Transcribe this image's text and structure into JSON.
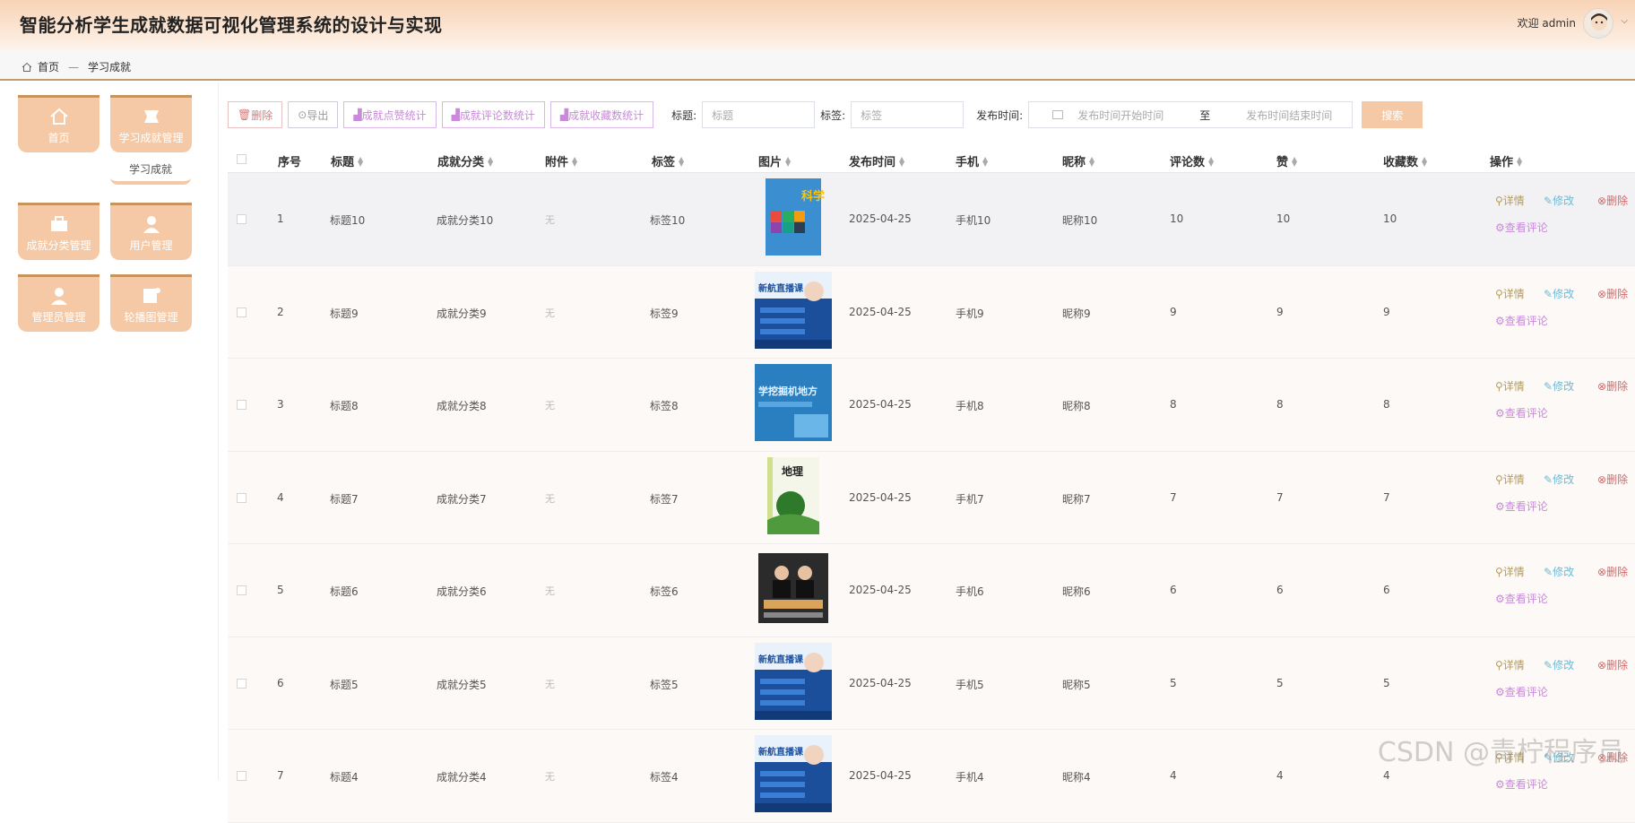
{
  "header": {
    "title": "智能分析学生成就数据可视化管理系统的设计与实现",
    "welcome": "欢迎 admin"
  },
  "breadcrumb": {
    "home": "首页",
    "separator": "—",
    "current": "学习成就"
  },
  "sidebar": {
    "items": [
      {
        "label": "首页",
        "icon": "home-icon"
      },
      {
        "label": "学习成就管理",
        "icon": "book-icon"
      },
      {
        "label": "成就分类管理",
        "icon": "briefcase-icon"
      },
      {
        "label": "用户管理",
        "icon": "user-icon"
      },
      {
        "label": "管理员管理",
        "icon": "admin-icon"
      },
      {
        "label": "轮播图管理",
        "icon": "carousel-icon"
      }
    ],
    "submenu": "学习成就"
  },
  "toolbar": {
    "delete": "删除",
    "export": "导出",
    "stat_likes": "成就点赞统计",
    "stat_comments": "成就评论数统计",
    "stat_favorites": "成就收藏数统计",
    "title_label": "标题:",
    "title_placeholder": "标题",
    "tag_label": "标签:",
    "tag_placeholder": "标签",
    "time_label": "发布时间:",
    "start_placeholder": "发布时间开始时间",
    "to": "至",
    "end_placeholder": "发布时间结束时间",
    "search": "搜索"
  },
  "table": {
    "headers": [
      "序号",
      "标题",
      "成就分类",
      "附件",
      "标签",
      "图片",
      "发布时间",
      "手机",
      "昵称",
      "评论数",
      "赞",
      "收藏数",
      "操作"
    ],
    "ops": {
      "detail": "详情",
      "edit": "修改",
      "delete": "删除",
      "comments": "查看评论"
    },
    "rows": [
      {
        "idx": "1",
        "title": "标题10",
        "category": "成就分类10",
        "attach": "无",
        "tag": "标签10",
        "date": "2025-04-25",
        "phone": "手机10",
        "nick": "昵称10",
        "comments": "10",
        "likes": "10",
        "favs": "10",
        "cover_text": "科学"
      },
      {
        "idx": "2",
        "title": "标题9",
        "category": "成就分类9",
        "attach": "无",
        "tag": "标签9",
        "date": "2025-04-25",
        "phone": "手机9",
        "nick": "昵称9",
        "comments": "9",
        "likes": "9",
        "favs": "9",
        "cover_text": "新航直播课"
      },
      {
        "idx": "3",
        "title": "标题8",
        "category": "成就分类8",
        "attach": "无",
        "tag": "标签8",
        "date": "2025-04-25",
        "phone": "手机8",
        "nick": "昵称8",
        "comments": "8",
        "likes": "8",
        "favs": "8",
        "cover_text": "学挖掘机地方"
      },
      {
        "idx": "4",
        "title": "标题7",
        "category": "成就分类7",
        "attach": "无",
        "tag": "标签7",
        "date": "2025-04-25",
        "phone": "手机7",
        "nick": "昵称7",
        "comments": "7",
        "likes": "7",
        "favs": "7",
        "cover_text": "地理"
      },
      {
        "idx": "5",
        "title": "标题6",
        "category": "成就分类6",
        "attach": "无",
        "tag": "标签6",
        "date": "2025-04-25",
        "phone": "手机6",
        "nick": "昵称6",
        "comments": "6",
        "likes": "6",
        "favs": "6",
        "cover_text": ""
      },
      {
        "idx": "6",
        "title": "标题5",
        "category": "成就分类5",
        "attach": "无",
        "tag": "标签5",
        "date": "2025-04-25",
        "phone": "手机5",
        "nick": "昵称5",
        "comments": "5",
        "likes": "5",
        "favs": "5",
        "cover_text": "新航直播课"
      },
      {
        "idx": "7",
        "title": "标题4",
        "category": "成就分类4",
        "attach": "无",
        "tag": "标签4",
        "date": "2025-04-25",
        "phone": "手机4",
        "nick": "昵称4",
        "comments": "4",
        "likes": "4",
        "favs": "4",
        "cover_text": "新航直播课"
      }
    ]
  },
  "watermark": "CSDN @青柠程序员",
  "colors": {
    "accent": "#f5c9a6",
    "accent_dark": "#c9935c"
  }
}
